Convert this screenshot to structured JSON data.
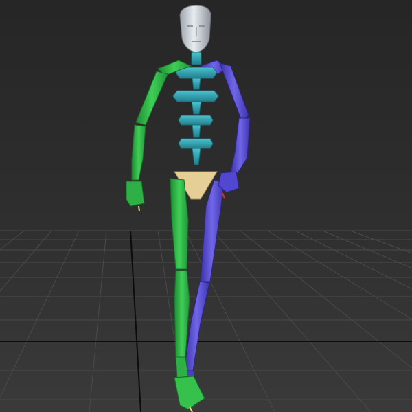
{
  "viewport": {
    "background": "#2b2b2b",
    "grid_color": "#4a4a4a",
    "axis_color": "#0c0c0c"
  },
  "biped": {
    "head_color": "#c9ced6",
    "spine_color": "#2fa6b4",
    "left_side_color": "#32b84a",
    "right_side_color": "#5a4fd6",
    "pelvis_color": "#e6cf96"
  }
}
